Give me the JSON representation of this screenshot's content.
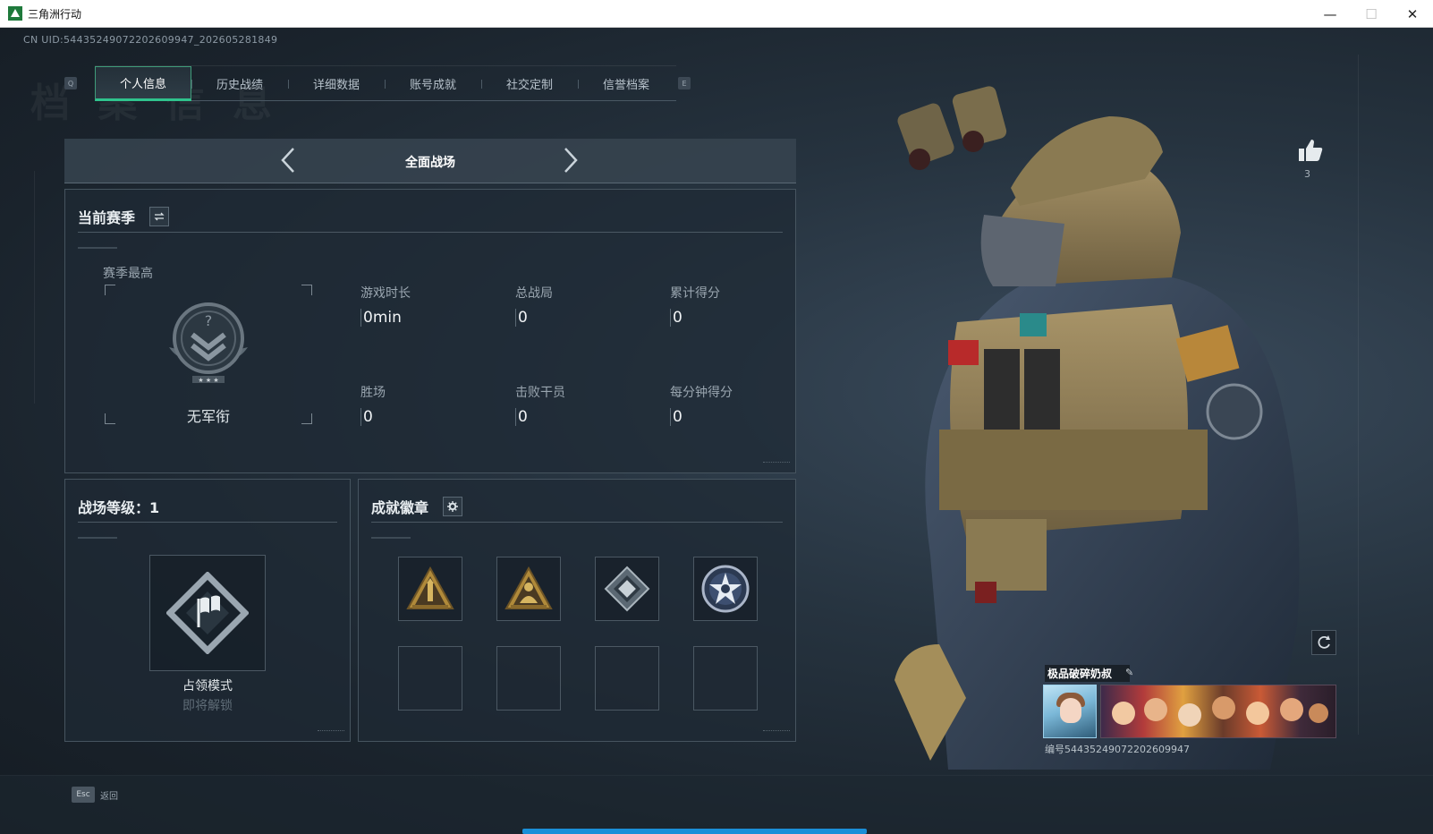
{
  "window": {
    "title": "三角洲行动",
    "controls": {
      "minimize": "—",
      "maximize": "☐",
      "close": "✕"
    }
  },
  "background": {
    "watermark": "档 案 信 息"
  },
  "uid": "CN UID:5443524907220260994​7_202605281849",
  "tabs": {
    "prev_key": "Q",
    "next_key": "E",
    "items": [
      {
        "label": "个人信息",
        "active": true
      },
      {
        "label": "历史战绩",
        "active": false
      },
      {
        "label": "详细数据",
        "active": false
      },
      {
        "label": "账号成就",
        "active": false
      },
      {
        "label": "社交定制",
        "active": false
      },
      {
        "label": "信誉档案",
        "active": false
      }
    ]
  },
  "mode_selector": {
    "title": "全面战场",
    "prev_icon": "chevron-left-icon",
    "next_icon": "chevron-right-icon"
  },
  "season": {
    "title": "当前赛季",
    "switch_icon": "swap-icon",
    "best_label": "赛季最高",
    "rank_label": "无军衔",
    "stats": [
      {
        "label": "游戏时长",
        "value": "0min"
      },
      {
        "label": "总战局",
        "value": "0"
      },
      {
        "label": "累计得分",
        "value": "0"
      },
      {
        "label": "胜场",
        "value": "0"
      },
      {
        "label": "击败干员",
        "value": "0"
      },
      {
        "label": "每分钟得分",
        "value": "0"
      }
    ]
  },
  "battlefield": {
    "title": "战场等级：1",
    "mode_name": "占领模式",
    "mode_status": "即将解锁"
  },
  "achievements": {
    "title": "成就徽章",
    "settings_icon": "gear-icon"
  },
  "profile": {
    "like_count": "3",
    "nickname": "极品破碎奶叔",
    "id_text": "编号5443524907220260994​7"
  },
  "footer": {
    "esc_key": "Esc",
    "esc_label": "返回"
  },
  "colors": {
    "accent_green": "#2fc38d",
    "accent_blue": "#1b8fd8",
    "background": "#1b2530"
  }
}
